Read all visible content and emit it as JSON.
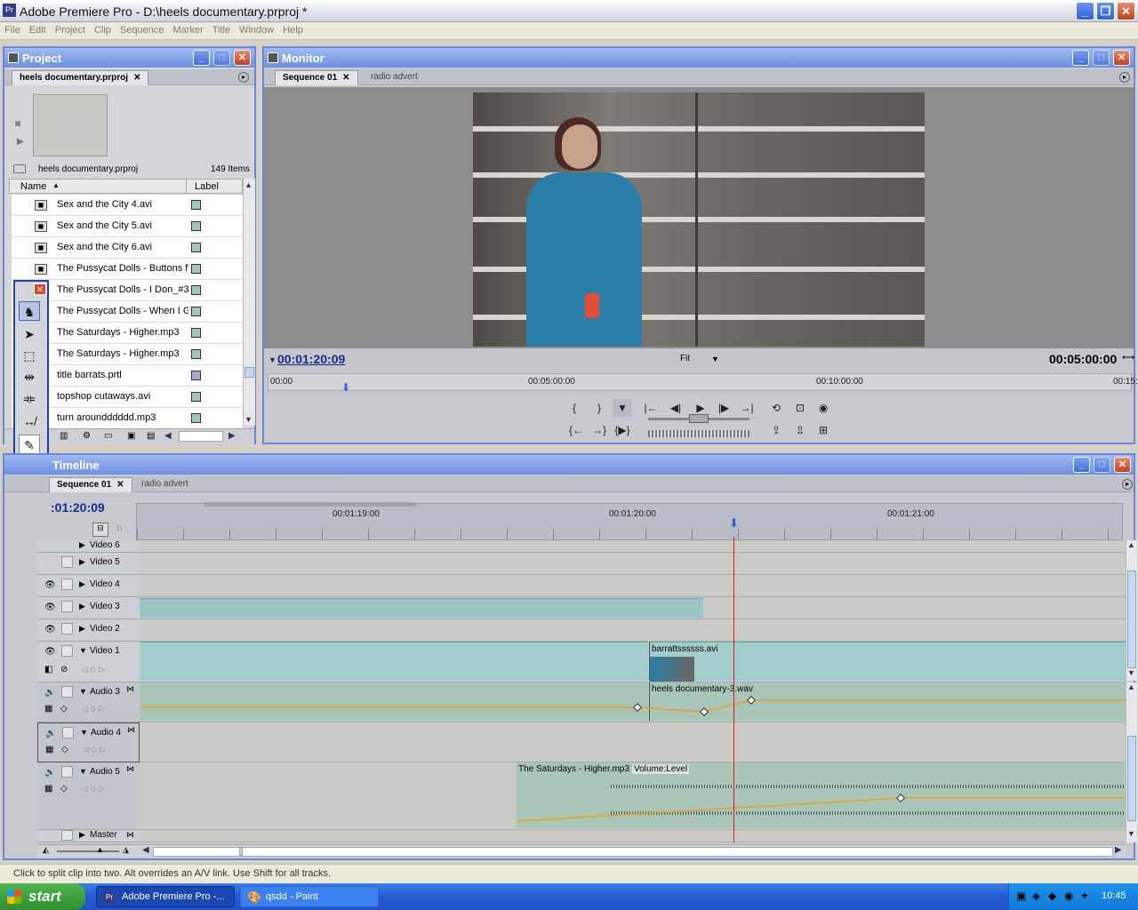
{
  "window": {
    "title": "Adobe Premiere Pro - D:\\heels documentary.prproj *"
  },
  "menu": [
    "File",
    "Edit",
    "Project",
    "Clip",
    "Sequence",
    "Marker",
    "Title",
    "Window",
    "Help"
  ],
  "project": {
    "panel_title": "Project",
    "tab": "heels documentary.prproj",
    "path": "heels documentary.prproj",
    "item_count": "149 Items",
    "col_name": "Name",
    "col_label": "Label",
    "items": [
      "Sex and the City 4.avi",
      "Sex and the City 5.avi",
      "Sex and the City 6.avi",
      "The Pussycat Dolls - Buttons ft.",
      "The Pussycat Dolls - I Don_#3",
      "The Pussycat Dolls - When I G",
      "The Saturdays - Higher.mp3",
      "The Saturdays - Higher.mp3",
      "title barrats.prtl",
      "topshop cutaways.avi",
      "turn aroundddddd.mp3"
    ],
    "label_colors": [
      "#9ec9b7",
      "#9ec9b7",
      "#9ec9b7",
      "#9ec9b7",
      "#9ec9b7",
      "#9ec9b7",
      "#9ec9b7",
      "#9ec9b7",
      "#a7a8d8",
      "#9ec9b7",
      "#9ec9b7"
    ]
  },
  "monitor": {
    "panel_title": "Monitor",
    "tabs": [
      "Sequence 01",
      "radio advert"
    ],
    "current_time": "00:01:20:09",
    "zoom": "Fit",
    "duration": "00:05:00:00",
    "ruler": [
      "00:00",
      "00:05:00:00",
      "00:10:00:00",
      "00:15:"
    ]
  },
  "timeline": {
    "panel_title": "Timeline",
    "tabs": [
      "Sequence 01",
      "radio advert"
    ],
    "current_time": ":01:20:09",
    "ruler": [
      "00:01:19:00",
      "00:01:20:00",
      "00:01:21:00"
    ],
    "video_tracks": [
      "Video 5",
      "Video 4",
      "Video 3",
      "Video 2",
      "Video 1"
    ],
    "video_top_partial": "Video 6",
    "audio_tracks": [
      "Audio 3",
      "Audio 4",
      "Audio 5"
    ],
    "master": "Master",
    "clip_video1": "barrattssssss.avi",
    "clip_audio3": "heels documentary-3.wav",
    "clip_audio5": "The Saturdays - Higher.mp3",
    "clip_audio5_fx": "Volume:Level"
  },
  "status": "Click to split clip into two. Alt overrides an A/V link. Use Shift for all tracks.",
  "taskbar": {
    "start": "start",
    "tasks": [
      "Adobe Premiere Pro -...",
      "qsdd - Paint"
    ],
    "clock": "10:45"
  },
  "colors": {
    "panel_head": "#6e8fdf",
    "taskbar": "#245cd0",
    "playhead": "#e0201e",
    "clip_video": "#9cc4c6"
  }
}
